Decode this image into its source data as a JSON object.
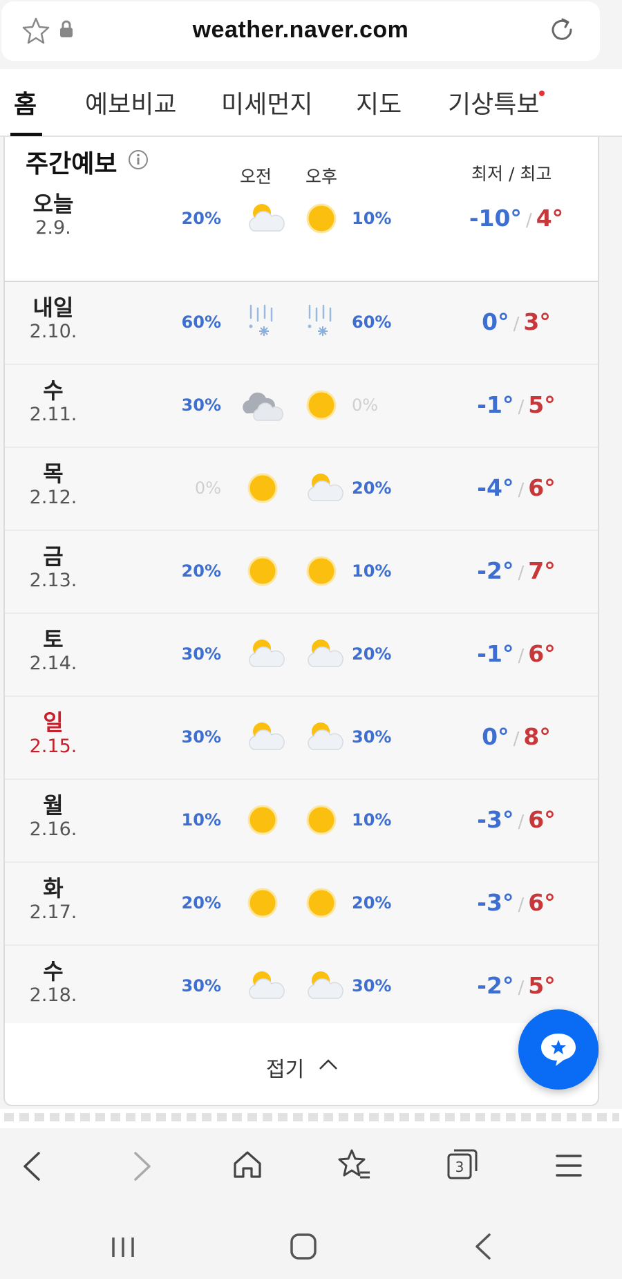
{
  "browser": {
    "url": "weather.naver.com"
  },
  "tabs": [
    {
      "label": "홈",
      "active": true
    },
    {
      "label": "예보비교"
    },
    {
      "label": "미세먼지"
    },
    {
      "label": "지도"
    },
    {
      "label": "기상특보",
      "has_alert_dot": true
    }
  ],
  "weekly": {
    "title": "주간예보",
    "am_label": "오전",
    "pm_label": "오후",
    "temp_header": "최저 / 최고",
    "collapse_label": "접기",
    "rows": [
      {
        "day": "오늘",
        "date": "2.9.",
        "am_pct": "20%",
        "am_icon": "partly-cloudy",
        "pm_icon": "sunny",
        "pm_pct": "10%",
        "low": "-10°",
        "high": "4°"
      },
      {
        "day": "내일",
        "date": "2.10.",
        "am_pct": "60%",
        "am_icon": "sleet",
        "pm_icon": "sleet",
        "pm_pct": "60%",
        "low": "0°",
        "high": "3°"
      },
      {
        "day": "수",
        "date": "2.11.",
        "am_pct": "30%",
        "am_icon": "cloudy",
        "pm_icon": "sunny",
        "pm_pct": "0%",
        "low": "-1°",
        "high": "5°"
      },
      {
        "day": "목",
        "date": "2.12.",
        "am_pct": "0%",
        "am_icon": "sunny",
        "pm_icon": "partly-cloudy",
        "pm_pct": "20%",
        "low": "-4°",
        "high": "6°"
      },
      {
        "day": "금",
        "date": "2.13.",
        "am_pct": "20%",
        "am_icon": "sunny",
        "pm_icon": "sunny",
        "pm_pct": "10%",
        "low": "-2°",
        "high": "7°"
      },
      {
        "day": "토",
        "date": "2.14.",
        "am_pct": "30%",
        "am_icon": "partly-cloudy",
        "pm_icon": "partly-cloudy",
        "pm_pct": "20%",
        "low": "-1°",
        "high": "6°"
      },
      {
        "day": "일",
        "date": "2.15.",
        "sunday": true,
        "am_pct": "30%",
        "am_icon": "partly-cloudy",
        "pm_icon": "partly-cloudy",
        "pm_pct": "30%",
        "low": "0°",
        "high": "8°"
      },
      {
        "day": "월",
        "date": "2.16.",
        "am_pct": "10%",
        "am_icon": "sunny",
        "pm_icon": "sunny",
        "pm_pct": "10%",
        "low": "-3°",
        "high": "6°"
      },
      {
        "day": "화",
        "date": "2.17.",
        "am_pct": "20%",
        "am_icon": "sunny",
        "pm_icon": "sunny",
        "pm_pct": "20%",
        "low": "-3°",
        "high": "6°"
      },
      {
        "day": "수",
        "date": "2.18.",
        "am_pct": "30%",
        "am_icon": "partly-cloudy",
        "pm_icon": "partly-cloudy",
        "pm_pct": "30%",
        "low": "-2°",
        "high": "5°"
      }
    ]
  },
  "bottom_nav": {
    "tab_count": "3"
  },
  "colors": {
    "low_temp": "#3c6fd1",
    "high_temp": "#c8383b",
    "sunday": "#c8202a",
    "accent": "#0a6cf5"
  }
}
